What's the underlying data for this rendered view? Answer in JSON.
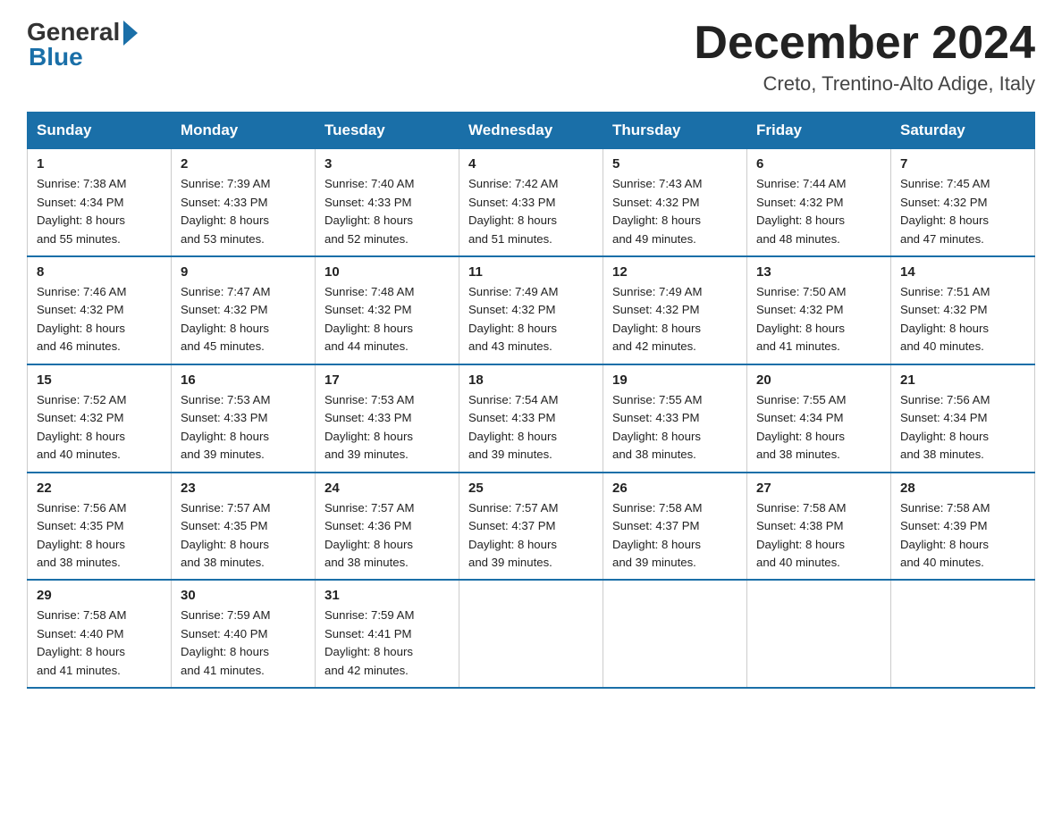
{
  "header": {
    "logo_general": "General",
    "logo_blue": "Blue",
    "month_title": "December 2024",
    "location": "Creto, Trentino-Alto Adige, Italy"
  },
  "days_of_week": [
    "Sunday",
    "Monday",
    "Tuesday",
    "Wednesday",
    "Thursday",
    "Friday",
    "Saturday"
  ],
  "weeks": [
    [
      {
        "day": "1",
        "sunrise": "7:38 AM",
        "sunset": "4:34 PM",
        "daylight": "8 hours and 55 minutes."
      },
      {
        "day": "2",
        "sunrise": "7:39 AM",
        "sunset": "4:33 PM",
        "daylight": "8 hours and 53 minutes."
      },
      {
        "day": "3",
        "sunrise": "7:40 AM",
        "sunset": "4:33 PM",
        "daylight": "8 hours and 52 minutes."
      },
      {
        "day": "4",
        "sunrise": "7:42 AM",
        "sunset": "4:33 PM",
        "daylight": "8 hours and 51 minutes."
      },
      {
        "day": "5",
        "sunrise": "7:43 AM",
        "sunset": "4:32 PM",
        "daylight": "8 hours and 49 minutes."
      },
      {
        "day": "6",
        "sunrise": "7:44 AM",
        "sunset": "4:32 PM",
        "daylight": "8 hours and 48 minutes."
      },
      {
        "day": "7",
        "sunrise": "7:45 AM",
        "sunset": "4:32 PM",
        "daylight": "8 hours and 47 minutes."
      }
    ],
    [
      {
        "day": "8",
        "sunrise": "7:46 AM",
        "sunset": "4:32 PM",
        "daylight": "8 hours and 46 minutes."
      },
      {
        "day": "9",
        "sunrise": "7:47 AM",
        "sunset": "4:32 PM",
        "daylight": "8 hours and 45 minutes."
      },
      {
        "day": "10",
        "sunrise": "7:48 AM",
        "sunset": "4:32 PM",
        "daylight": "8 hours and 44 minutes."
      },
      {
        "day": "11",
        "sunrise": "7:49 AM",
        "sunset": "4:32 PM",
        "daylight": "8 hours and 43 minutes."
      },
      {
        "day": "12",
        "sunrise": "7:49 AM",
        "sunset": "4:32 PM",
        "daylight": "8 hours and 42 minutes."
      },
      {
        "day": "13",
        "sunrise": "7:50 AM",
        "sunset": "4:32 PM",
        "daylight": "8 hours and 41 minutes."
      },
      {
        "day": "14",
        "sunrise": "7:51 AM",
        "sunset": "4:32 PM",
        "daylight": "8 hours and 40 minutes."
      }
    ],
    [
      {
        "day": "15",
        "sunrise": "7:52 AM",
        "sunset": "4:32 PM",
        "daylight": "8 hours and 40 minutes."
      },
      {
        "day": "16",
        "sunrise": "7:53 AM",
        "sunset": "4:33 PM",
        "daylight": "8 hours and 39 minutes."
      },
      {
        "day": "17",
        "sunrise": "7:53 AM",
        "sunset": "4:33 PM",
        "daylight": "8 hours and 39 minutes."
      },
      {
        "day": "18",
        "sunrise": "7:54 AM",
        "sunset": "4:33 PM",
        "daylight": "8 hours and 39 minutes."
      },
      {
        "day": "19",
        "sunrise": "7:55 AM",
        "sunset": "4:33 PM",
        "daylight": "8 hours and 38 minutes."
      },
      {
        "day": "20",
        "sunrise": "7:55 AM",
        "sunset": "4:34 PM",
        "daylight": "8 hours and 38 minutes."
      },
      {
        "day": "21",
        "sunrise": "7:56 AM",
        "sunset": "4:34 PM",
        "daylight": "8 hours and 38 minutes."
      }
    ],
    [
      {
        "day": "22",
        "sunrise": "7:56 AM",
        "sunset": "4:35 PM",
        "daylight": "8 hours and 38 minutes."
      },
      {
        "day": "23",
        "sunrise": "7:57 AM",
        "sunset": "4:35 PM",
        "daylight": "8 hours and 38 minutes."
      },
      {
        "day": "24",
        "sunrise": "7:57 AM",
        "sunset": "4:36 PM",
        "daylight": "8 hours and 38 minutes."
      },
      {
        "day": "25",
        "sunrise": "7:57 AM",
        "sunset": "4:37 PM",
        "daylight": "8 hours and 39 minutes."
      },
      {
        "day": "26",
        "sunrise": "7:58 AM",
        "sunset": "4:37 PM",
        "daylight": "8 hours and 39 minutes."
      },
      {
        "day": "27",
        "sunrise": "7:58 AM",
        "sunset": "4:38 PM",
        "daylight": "8 hours and 40 minutes."
      },
      {
        "day": "28",
        "sunrise": "7:58 AM",
        "sunset": "4:39 PM",
        "daylight": "8 hours and 40 minutes."
      }
    ],
    [
      {
        "day": "29",
        "sunrise": "7:58 AM",
        "sunset": "4:40 PM",
        "daylight": "8 hours and 41 minutes."
      },
      {
        "day": "30",
        "sunrise": "7:59 AM",
        "sunset": "4:40 PM",
        "daylight": "8 hours and 41 minutes."
      },
      {
        "day": "31",
        "sunrise": "7:59 AM",
        "sunset": "4:41 PM",
        "daylight": "8 hours and 42 minutes."
      },
      null,
      null,
      null,
      null
    ]
  ],
  "labels": {
    "sunrise": "Sunrise:",
    "sunset": "Sunset:",
    "daylight": "Daylight:"
  }
}
